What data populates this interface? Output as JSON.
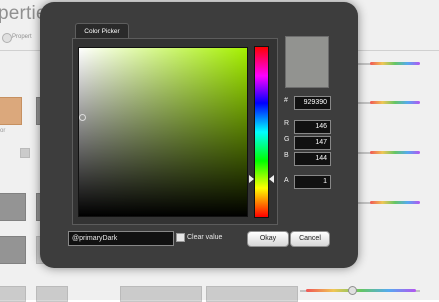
{
  "background": {
    "title": "perties: Color Palette",
    "breadcrumb": "Propert",
    "side_label": "or"
  },
  "dialog": {
    "tab_label": "Color Picker",
    "preview_color": "#929390",
    "hex_label": "#",
    "hex_value": "929390",
    "r_label": "R",
    "r_value": "146",
    "g_label": "G",
    "g_value": "147",
    "b_label": "B",
    "b_value": "144",
    "a_label": "A",
    "a_value": "1",
    "name_value": "@primaryDark",
    "clear_value_label": "Clear value",
    "clear_value_checked": false,
    "ok_label": "Okay",
    "cancel_label": "Cancel"
  }
}
